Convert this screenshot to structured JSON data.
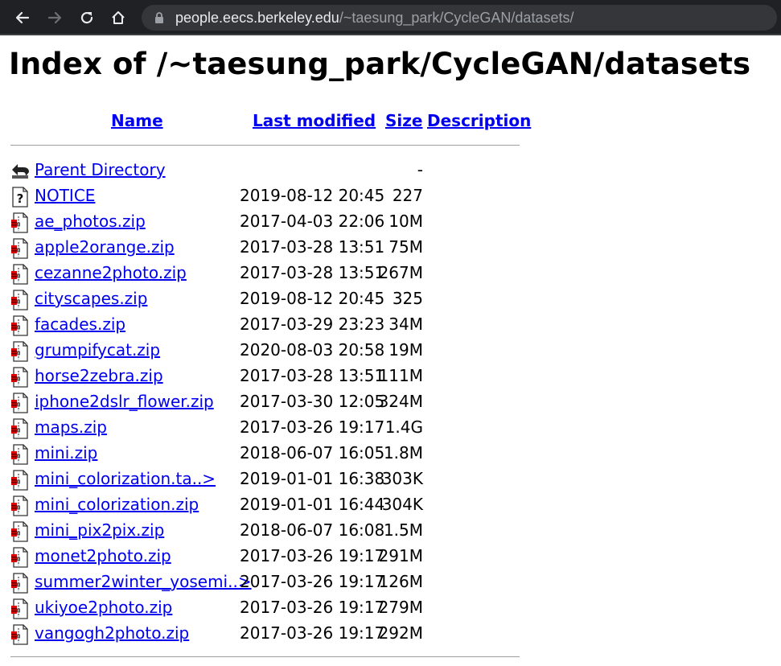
{
  "browser": {
    "back_icon": "arrow-left-icon",
    "forward_icon": "arrow-right-icon",
    "reload_icon": "reload-icon",
    "home_icon": "home-icon",
    "url_host": "people.eecs.berkeley.edu",
    "url_path": "/~taesung_park/CycleGAN/datasets/"
  },
  "page": {
    "title": "Index of /~taesung_park/CycleGAN/datasets"
  },
  "columns": {
    "name": "Name",
    "last_modified": "Last modified",
    "size": "Size",
    "description": "Description"
  },
  "entries": [
    {
      "name": "Parent Directory",
      "date": "",
      "size": "-",
      "icon": "parent-directory-icon"
    },
    {
      "name": "NOTICE",
      "date": "2019-08-12 20:45",
      "size": "227",
      "icon": "unknown-file-icon"
    },
    {
      "name": "ae_photos.zip",
      "date": "2017-04-03 22:06",
      "size": "10M",
      "icon": "compressed-file-icon"
    },
    {
      "name": "apple2orange.zip",
      "date": "2017-03-28 13:51",
      "size": "75M",
      "icon": "compressed-file-icon"
    },
    {
      "name": "cezanne2photo.zip",
      "date": "2017-03-28 13:51",
      "size": "267M",
      "icon": "compressed-file-icon"
    },
    {
      "name": "cityscapes.zip",
      "date": "2019-08-12 20:45",
      "size": "325",
      "icon": "compressed-file-icon"
    },
    {
      "name": "facades.zip",
      "date": "2017-03-29 23:23",
      "size": "34M",
      "icon": "compressed-file-icon"
    },
    {
      "name": "grumpifycat.zip",
      "date": "2020-08-03 20:58",
      "size": "19M",
      "icon": "compressed-file-icon"
    },
    {
      "name": "horse2zebra.zip",
      "date": "2017-03-28 13:51",
      "size": "111M",
      "icon": "compressed-file-icon"
    },
    {
      "name": "iphone2dslr_flower.zip",
      "date": "2017-03-30 12:05",
      "size": "324M",
      "icon": "compressed-file-icon"
    },
    {
      "name": "maps.zip",
      "date": "2017-03-26 19:17",
      "size": "1.4G",
      "icon": "compressed-file-icon"
    },
    {
      "name": "mini.zip",
      "date": "2018-06-07 16:05",
      "size": "1.8M",
      "icon": "compressed-file-icon"
    },
    {
      "name": "mini_colorization.ta..>",
      "date": "2019-01-01 16:38",
      "size": "303K",
      "icon": "compressed-file-icon"
    },
    {
      "name": "mini_colorization.zip",
      "date": "2019-01-01 16:44",
      "size": "304K",
      "icon": "compressed-file-icon"
    },
    {
      "name": "mini_pix2pix.zip",
      "date": "2018-06-07 16:08",
      "size": "1.5M",
      "icon": "compressed-file-icon"
    },
    {
      "name": "monet2photo.zip",
      "date": "2017-03-26 19:17",
      "size": "291M",
      "icon": "compressed-file-icon"
    },
    {
      "name": "summer2winter_yosemi..>",
      "date": "2017-03-26 19:17",
      "size": "126M",
      "icon": "compressed-file-icon"
    },
    {
      "name": "ukiyoe2photo.zip",
      "date": "2017-03-26 19:17",
      "size": "279M",
      "icon": "compressed-file-icon"
    },
    {
      "name": "vangogh2photo.zip",
      "date": "2017-03-26 19:17",
      "size": "292M",
      "icon": "compressed-file-icon"
    }
  ],
  "colors": {
    "link": "#0000ee",
    "browser_bar": "#202124",
    "omnibox": "#35363a"
  }
}
